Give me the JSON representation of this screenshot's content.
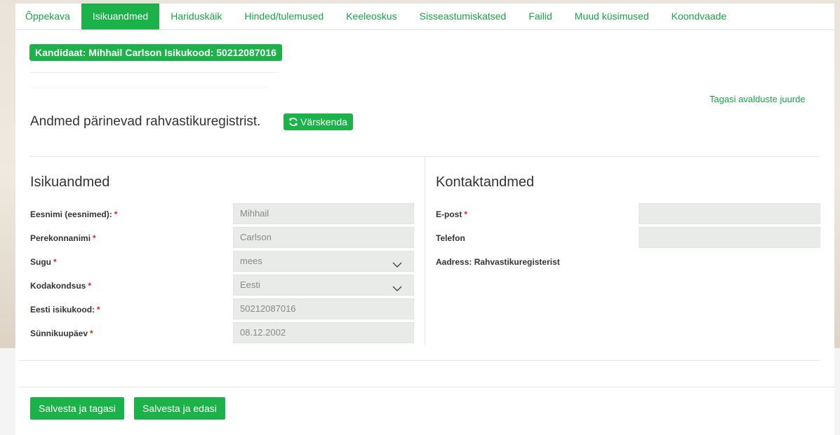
{
  "tabs": [
    {
      "label": "Õppekava"
    },
    {
      "label": "Isikuandmed"
    },
    {
      "label": "Hariduskäik"
    },
    {
      "label": "Hinded/tulemused"
    },
    {
      "label": "Keeleoskus"
    },
    {
      "label": "Sisseastumiskatsed"
    },
    {
      "label": "Failid"
    },
    {
      "label": "Muud küsimused"
    },
    {
      "label": "Koondvaade"
    }
  ],
  "active_tab": "Isikuandmed",
  "candidate": {
    "badge": "Kandidaat: Mihhail Carlson Isikukood: 50212087016"
  },
  "back_link": "Tagasi avalduste juurde",
  "registry": {
    "text": "Andmed pärinevad rahvastikuregistrist.",
    "refresh_label": "Värskenda"
  },
  "personal": {
    "title": "Isikuandmed",
    "fields": {
      "first_name": {
        "label": "Eesnimi (eesnimed):",
        "value": "Mihhail",
        "required": "*"
      },
      "last_name": {
        "label": "Perekonnanimi",
        "value": "Carlson",
        "required": "*"
      },
      "gender": {
        "label": "Sugu",
        "value": "mees",
        "required": "*"
      },
      "citizenship": {
        "label": "Kodakondsus",
        "value": "Eesti",
        "required": "*"
      },
      "id_code": {
        "label": "Eesti isikukood:",
        "value": "50212087016",
        "required": "*"
      },
      "birth_date": {
        "label": "Sünnikuupäev",
        "value": "08.12.2002",
        "required": "*"
      }
    }
  },
  "contact": {
    "title": "Kontaktandmed",
    "email": {
      "label": "E-post",
      "value": "",
      "required": "*"
    },
    "phone": {
      "label": "Telefon",
      "value": ""
    },
    "address": {
      "label": "Aadress: Rahvastikuregisterist",
      "value": ""
    }
  },
  "buttons": {
    "save_back": "Salvesta ja tagasi",
    "save_next": "Salvesta ja edasi"
  },
  "colors": {
    "accent": "#1cb24a",
    "required": "#d9261c"
  }
}
